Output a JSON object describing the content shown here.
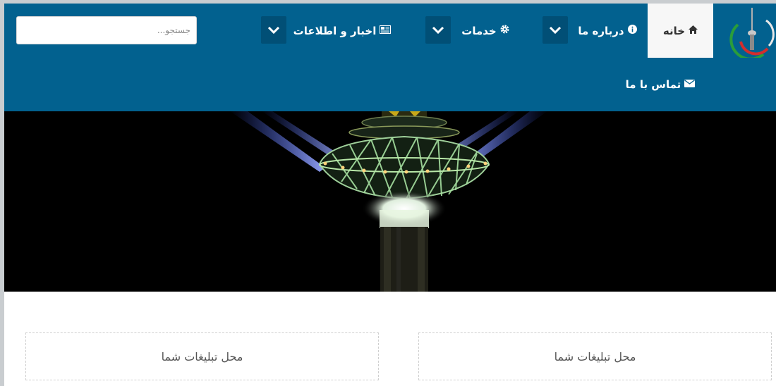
{
  "nav": {
    "home": {
      "label": "خانه",
      "icon": "home-icon"
    },
    "about": {
      "label": "درباره ما",
      "icon": "info-icon"
    },
    "services": {
      "label": "خدمات",
      "icon": "gear-icon"
    },
    "news": {
      "label": "اخبار و اطلاعات",
      "icon": "newspaper-icon"
    },
    "contact": {
      "label": "تماس با ما",
      "icon": "envelope-icon"
    }
  },
  "search": {
    "placeholder": "جستجو..."
  },
  "ads": {
    "right": "محل تبلیغات شما",
    "left": "محل تبلیغات شما"
  },
  "colors": {
    "navbar": "#02618f",
    "dropdown": "#014f76",
    "active_tab": "#f7f7f7"
  }
}
